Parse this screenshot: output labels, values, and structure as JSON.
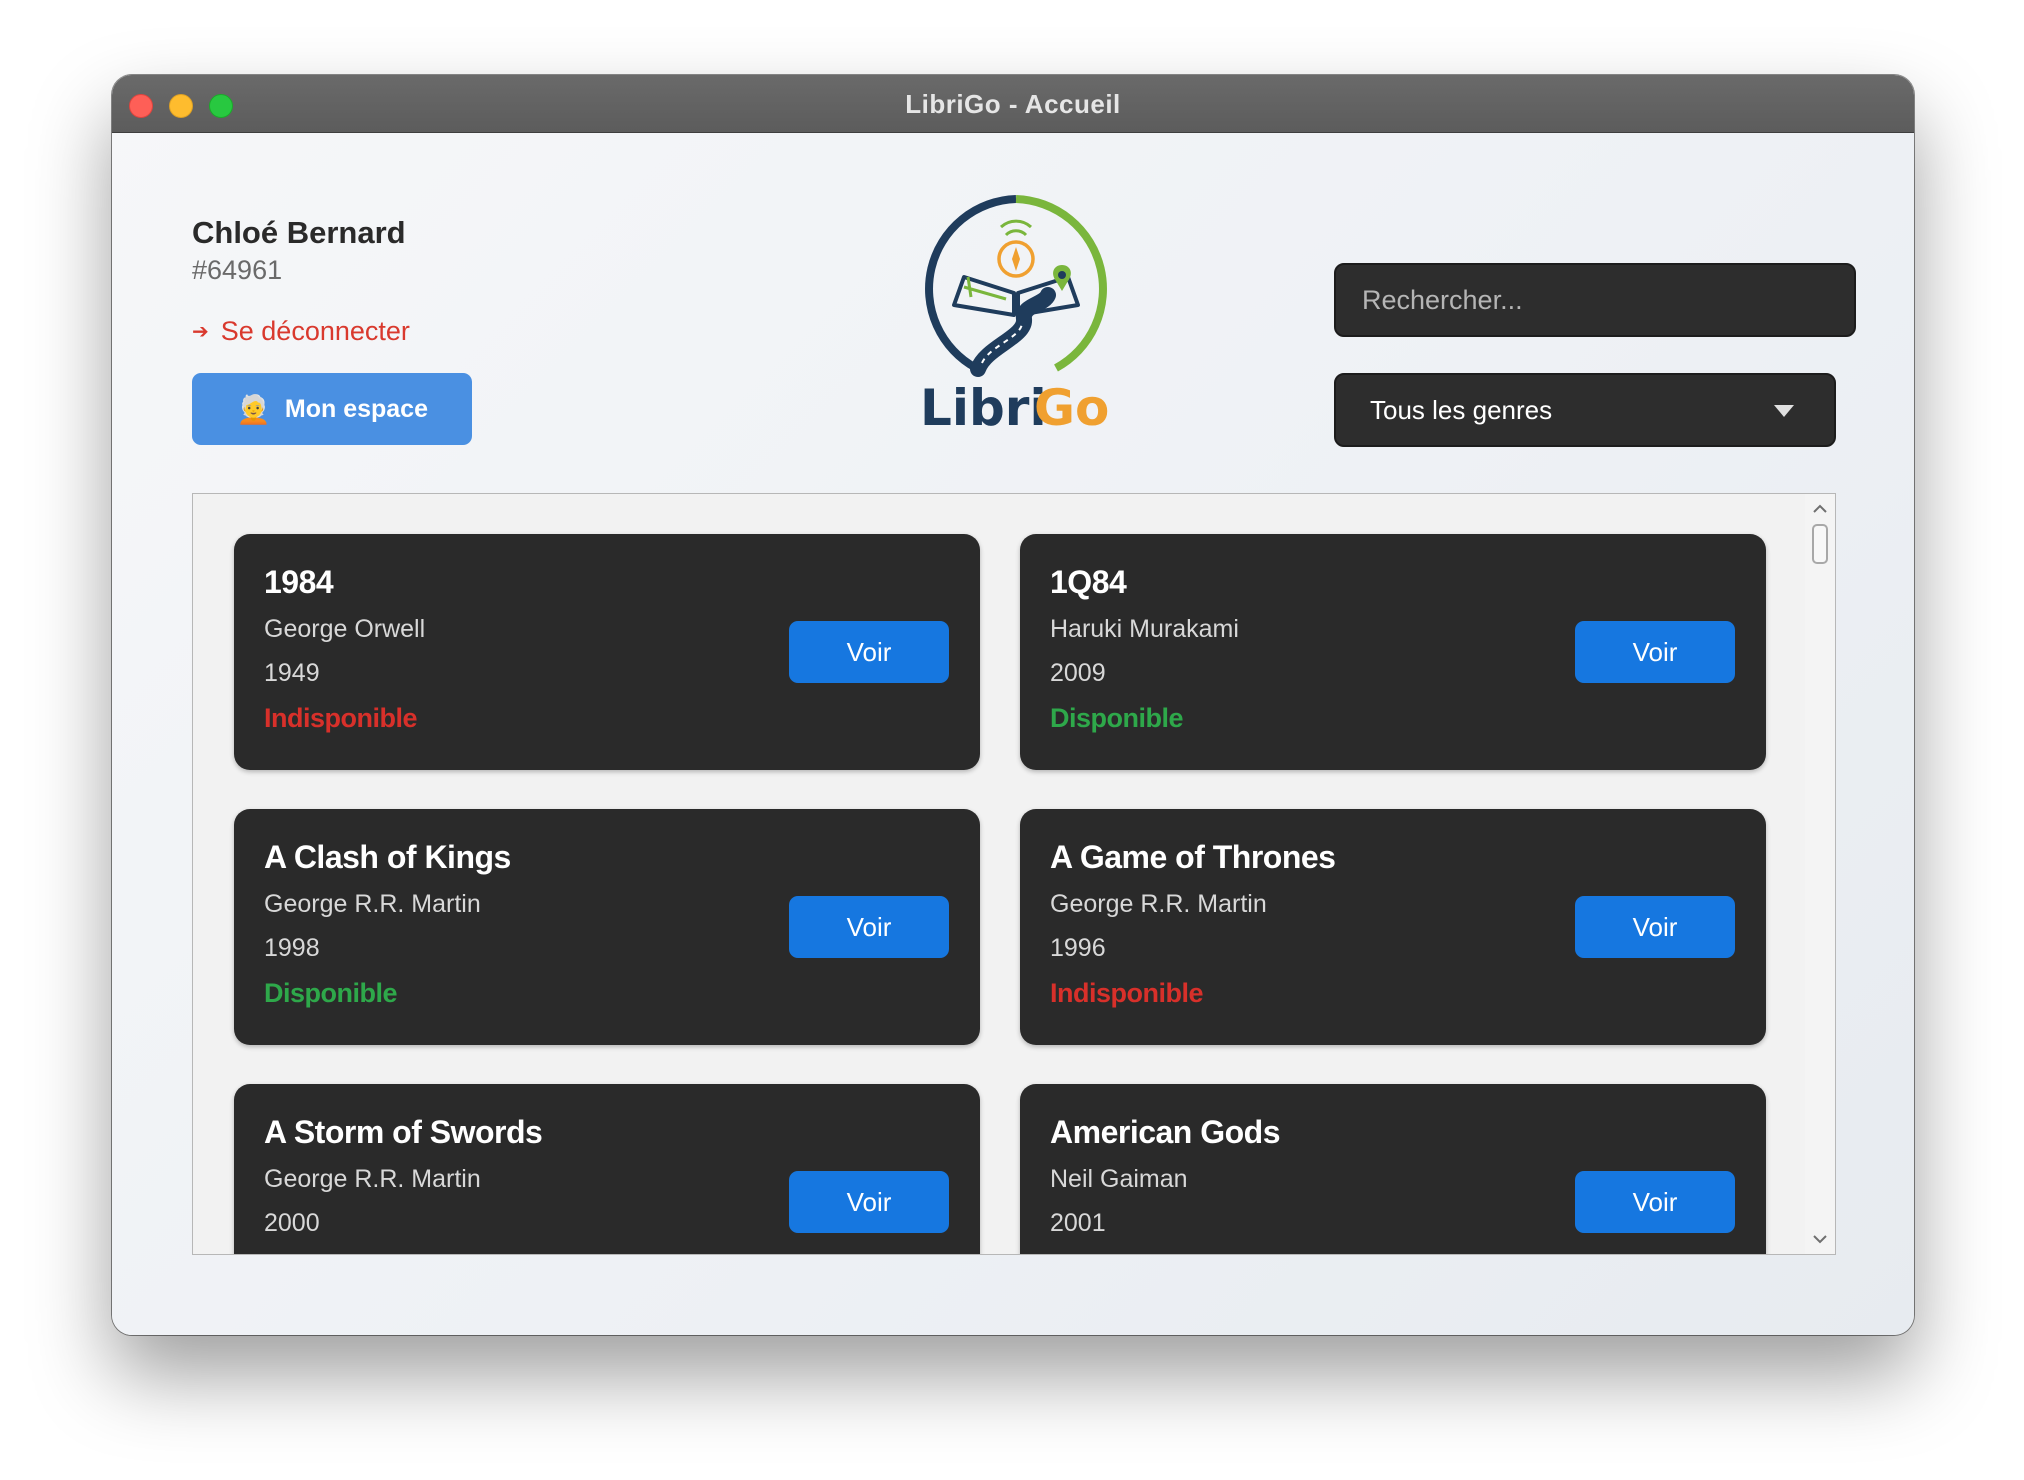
{
  "window": {
    "title": "LibriGo - Accueil"
  },
  "user": {
    "name": "Chloé Bernard",
    "id": "#64961",
    "logout_label": "Se déconnecter",
    "my_space_label": "Mon espace",
    "my_space_emoji": "🧑‍🦳"
  },
  "logo": {
    "text_part1": "Libri",
    "text_part2": "Go",
    "colors": {
      "navy": "#1f3c5c",
      "green": "#7ab63c",
      "orange": "#f0a030"
    }
  },
  "search": {
    "placeholder": "Rechercher...",
    "value": ""
  },
  "genre_filter": {
    "selected": "Tous les genres"
  },
  "books": [
    {
      "title": "1984",
      "author": "George Orwell",
      "year": "1949",
      "status": "Indisponible",
      "available": false,
      "button": "Voir"
    },
    {
      "title": "1Q84",
      "author": "Haruki Murakami",
      "year": "2009",
      "status": "Disponible",
      "available": true,
      "button": "Voir"
    },
    {
      "title": "A Clash of Kings",
      "author": "George R.R. Martin",
      "year": "1998",
      "status": "Disponible",
      "available": true,
      "button": "Voir"
    },
    {
      "title": "A Game of Thrones",
      "author": "George R.R. Martin",
      "year": "1996",
      "status": "Indisponible",
      "available": false,
      "button": "Voir"
    },
    {
      "title": "A Storm of Swords",
      "author": "George R.R. Martin",
      "year": "2000",
      "status": "",
      "available": null,
      "button": "Voir"
    },
    {
      "title": "American Gods",
      "author": "Neil Gaiman",
      "year": "2001",
      "status": "",
      "available": null,
      "button": "Voir"
    }
  ],
  "colors": {
    "accent_blue": "#1677e0",
    "my_space_blue": "#4a90e2",
    "available_green": "#2ea84a",
    "unavailable_red": "#d8302a",
    "card_bg": "#2a2a2a"
  }
}
